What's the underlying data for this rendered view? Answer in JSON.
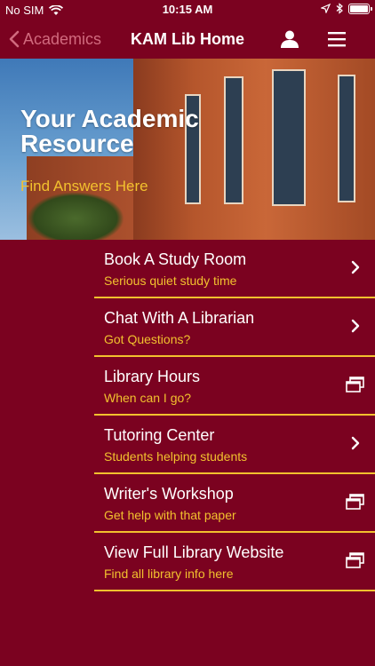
{
  "status": {
    "carrier": "No SIM",
    "time": "10:15 AM"
  },
  "nav": {
    "back_label": "Academics",
    "title": "KAM Lib Home"
  },
  "hero": {
    "title": "Your Academic Resource",
    "subtitle": "Find Answers Here"
  },
  "menu": [
    {
      "label": "Book A Study Room",
      "sub": "Serious quiet study time",
      "icon": "chevron-right-icon"
    },
    {
      "label": "Chat With A Librarian",
      "sub": "Got Questions?",
      "icon": "chevron-right-icon"
    },
    {
      "label": "Library Hours",
      "sub": "When can I go?",
      "icon": "external-window-icon"
    },
    {
      "label": "Tutoring Center",
      "sub": "Students helping students",
      "icon": "chevron-right-icon"
    },
    {
      "label": "Writer's Workshop",
      "sub": "Get help with that paper",
      "icon": "external-window-icon"
    },
    {
      "label": "View Full Library Website",
      "sub": "Find all library info here",
      "icon": "external-window-icon"
    }
  ],
  "colors": {
    "background": "#7b0220",
    "accent": "#f2c12e",
    "back_link": "#d16a7e"
  }
}
